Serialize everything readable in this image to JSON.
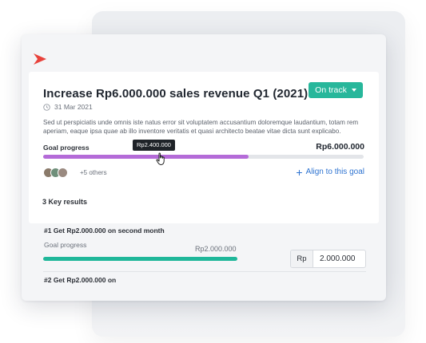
{
  "goal": {
    "title": "Increase Rp6.000.000 sales revenue Q1 (2021)",
    "status": "On track",
    "date": "31 Mar 2021",
    "description": "Sed ut perspiciatis unde omnis iste natus error sit voluptatem accusantium doloremque laudantium, totam rem aperiam, eaque ipsa quae ab illo inventore veritatis et quasi architecto beatae vitae dicta sunt explicabo.",
    "progress_label": "Goal progress",
    "target": "Rp6.000.000",
    "current_tooltip": "Rp2.400.000",
    "progress_fraction": 0.64,
    "others_text": "+5 others",
    "align_label": "Align to this goal"
  },
  "key_results": {
    "heading": "3 Key results",
    "items": [
      {
        "title": "#1 Get Rp2.000.000 on second month",
        "progress_label": "Goal progress",
        "target": "Rp2.000.000",
        "currency": "Rp",
        "value": "2.000.000"
      },
      {
        "title": "#2 Get Rp2.000.000 on"
      }
    ]
  },
  "colors": {
    "status": "#27b79b",
    "goal_bar": "#b46bd8",
    "kr_bar": "#1fb79a",
    "link": "#2f74d1",
    "logo": "#e8423b"
  },
  "icons": [
    "brand-logo-icon",
    "clock-icon",
    "caret-down-icon",
    "plus-icon",
    "hand-cursor-icon"
  ]
}
